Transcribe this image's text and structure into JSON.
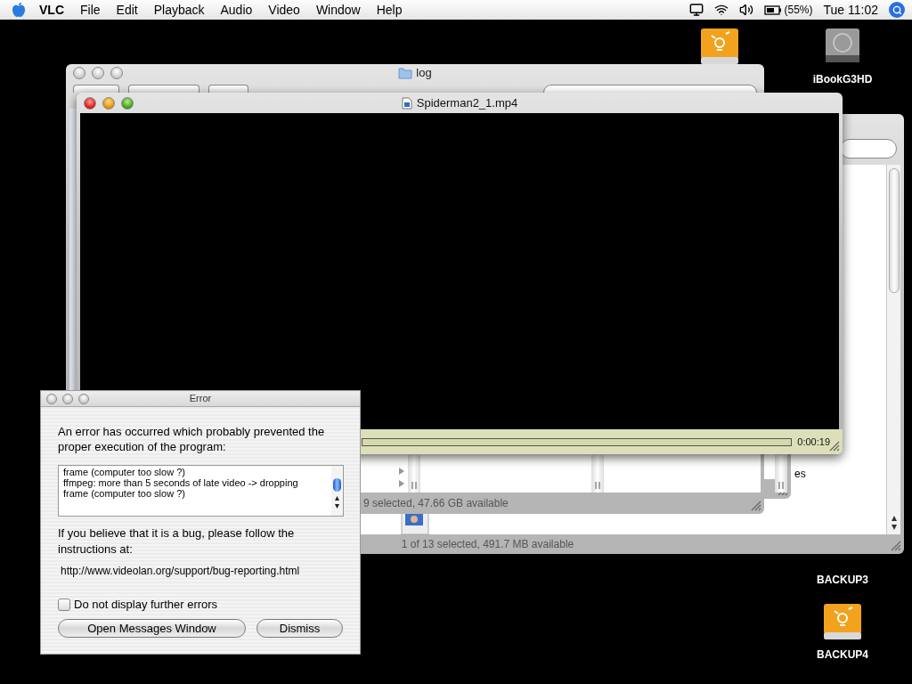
{
  "menu_bar": {
    "app": "VLC",
    "menus": [
      "File",
      "Edit",
      "Playback",
      "Audio",
      "Video",
      "Window",
      "Help"
    ],
    "battery": "(55%)",
    "clock": "Tue 11:02"
  },
  "desktop_icons": [
    {
      "kind": "firewire"
    },
    {
      "kind": "disk",
      "label": "iBookG3HD"
    },
    {
      "kind": "label_only",
      "label": "BACKUP3"
    },
    {
      "kind": "firewire",
      "label": "BACKUP4"
    }
  ],
  "finder_back": {
    "status": "1 of 13 selected, 491.7 MB available",
    "cut_label": "es"
  },
  "finder_log": {
    "active": false,
    "title": "log",
    "status": "9 selected, 47.66 GB available"
  },
  "player": {
    "active": true,
    "title": "Spiderman2_1.mp4",
    "time": "0:00:19"
  },
  "error_dialog": {
    "active": false,
    "title": "Error",
    "message": "An error has occurred which probably prevented the proper execution of the program:",
    "log_lines": [
      "frame (computer too slow ?)",
      "ffmpeg: more than 5 seconds of late video -> dropping",
      "frame (computer too slow ?)"
    ],
    "bug_text": "If you believe that it is a bug, please follow the instructions at:",
    "url": "http://www.videolan.org/support/bug-reporting.html",
    "checkbox": {
      "label": "Do not display further errors",
      "checked": false
    },
    "buttons": [
      "Open Messages Window",
      "Dismiss"
    ]
  }
}
